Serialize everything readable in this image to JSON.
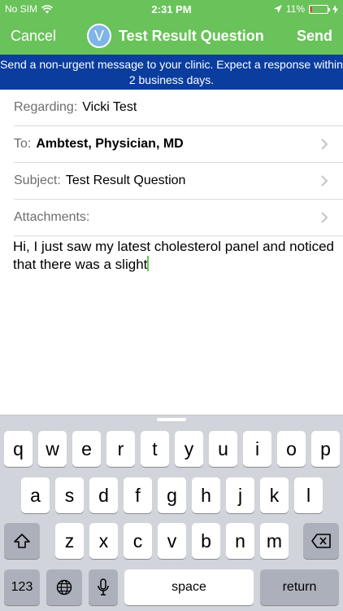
{
  "status_bar": {
    "carrier": "No SIM",
    "time": "2:31 PM",
    "battery_percent": "11%",
    "battery_level": 0.11
  },
  "nav": {
    "cancel_label": "Cancel",
    "avatar_initial": "V",
    "title": "Test Result Question",
    "send_label": "Send"
  },
  "banner": {
    "text": "Send a non-urgent message to your clinic. Expect a response within 2 business days."
  },
  "form": {
    "regarding_label": "Regarding:",
    "regarding_value": "Vicki Test",
    "to_label": "To:",
    "to_value": "Ambtest, Physician, MD",
    "subject_label": "Subject:",
    "subject_value": "Test Result Question",
    "attachments_label": "Attachments:"
  },
  "message": {
    "body": "Hi, I just saw my latest cholesterol panel and noticed that there was a slight"
  },
  "keyboard": {
    "row1": [
      "q",
      "w",
      "e",
      "r",
      "t",
      "y",
      "u",
      "i",
      "o",
      "p"
    ],
    "row2": [
      "a",
      "s",
      "d",
      "f",
      "g",
      "h",
      "j",
      "k",
      "l"
    ],
    "row3": [
      "z",
      "x",
      "c",
      "v",
      "b",
      "n",
      "m"
    ],
    "numbers_label": "123",
    "space_label": "space",
    "return_label": "return"
  },
  "colors": {
    "header_green": "#6ac25a",
    "banner_blue": "#0a3d9e",
    "keyboard_bg": "#d1d4da"
  }
}
